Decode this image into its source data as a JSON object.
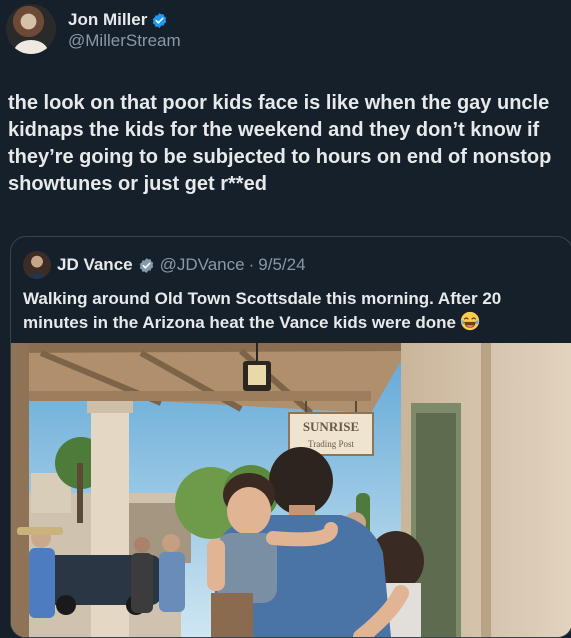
{
  "tweet": {
    "author": {
      "display_name": "Jon Miller",
      "handle": "@MillerStream",
      "verified_icon": "verified-badge-icon"
    },
    "text": "the look on that poor kids face is like when the gay uncle\nkidnaps the kids for the weekend and they don’t know if\nthey’re going to be subjected to hours on end of nonstop\nshowtunes or just get r**ed"
  },
  "quoted_tweet": {
    "author": {
      "display_name": "JD Vance",
      "handle": "@JDVance",
      "verified_icon": "verified-badge-gray-icon"
    },
    "separator": "·",
    "date": "9/5/24",
    "text": "Walking around Old Town Scottsdale this morning. After 20\nminutes in the Arizona heat the Vance kids were done",
    "emoji": "laughing-tears-emoji-icon",
    "photo": {
      "sign_line1": "SUNRISE",
      "sign_line2": "Trading Post"
    }
  },
  "colors": {
    "background": "#15202b",
    "text_primary": "#e7e9ea",
    "text_secondary": "#8b98a5",
    "verified_blue": "#1d9bf0",
    "border": "#38444d"
  }
}
